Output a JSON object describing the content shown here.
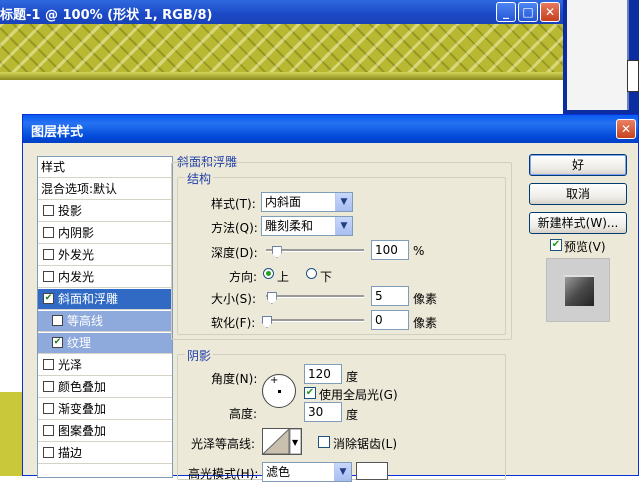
{
  "doc_window": {
    "title": "标题-1 @ 100% (形状 1, RGB/8)",
    "minimize": "_",
    "maximize": "□",
    "close": "✕"
  },
  "dialog": {
    "title": "图层样式",
    "close": "✕"
  },
  "styles_list": {
    "header": "样式",
    "blend": "混合选项:默认",
    "items": [
      {
        "label": "投影",
        "checked": false
      },
      {
        "label": "内阴影",
        "checked": false
      },
      {
        "label": "外发光",
        "checked": false
      },
      {
        "label": "内发光",
        "checked": false
      },
      {
        "label": "斜面和浮雕",
        "checked": true
      },
      {
        "label": "等高线",
        "checked": false
      },
      {
        "label": "纹理",
        "checked": true
      },
      {
        "label": "光泽",
        "checked": false
      },
      {
        "label": "颜色叠加",
        "checked": false
      },
      {
        "label": "渐变叠加",
        "checked": false
      },
      {
        "label": "图案叠加",
        "checked": false
      },
      {
        "label": "描边",
        "checked": false
      }
    ]
  },
  "bevel": {
    "section_title": "斜面和浮雕",
    "structure_title": "结构",
    "style_label": "样式(T):",
    "style_value": "内斜面",
    "technique_label": "方法(Q):",
    "technique_value": "雕刻柔和",
    "depth_label": "深度(D):",
    "depth_value": "100",
    "depth_unit": "%",
    "depth_fraction": 0.1,
    "direction_label": "方向:",
    "direction_up": "上",
    "direction_down": "下",
    "direction_selected": "上",
    "size_label": "大小(S):",
    "size_value": "5",
    "size_unit": "像素",
    "size_fraction": 0.05,
    "soften_label": "软化(F):",
    "soften_value": "0",
    "soften_unit": "像素",
    "soften_fraction": 0
  },
  "shading": {
    "title": "阴影",
    "angle_label": "角度(N):",
    "angle_value": "120",
    "angle_unit": "度",
    "global_light_label": "使用全局光(G)",
    "global_light_checked": true,
    "altitude_label": "高度:",
    "altitude_value": "30",
    "altitude_unit": "度",
    "gloss_contour_label": "光泽等高线:",
    "anti_alias_label": "消除锯齿(L)",
    "anti_alias_checked": false,
    "highlight_mode_label": "高光模式(H):",
    "highlight_mode_value": "滤色"
  },
  "buttons": {
    "ok": "好",
    "cancel": "取消",
    "new_style": "新建样式(W)...",
    "preview_label": "预览(V)",
    "preview_checked": true
  }
}
